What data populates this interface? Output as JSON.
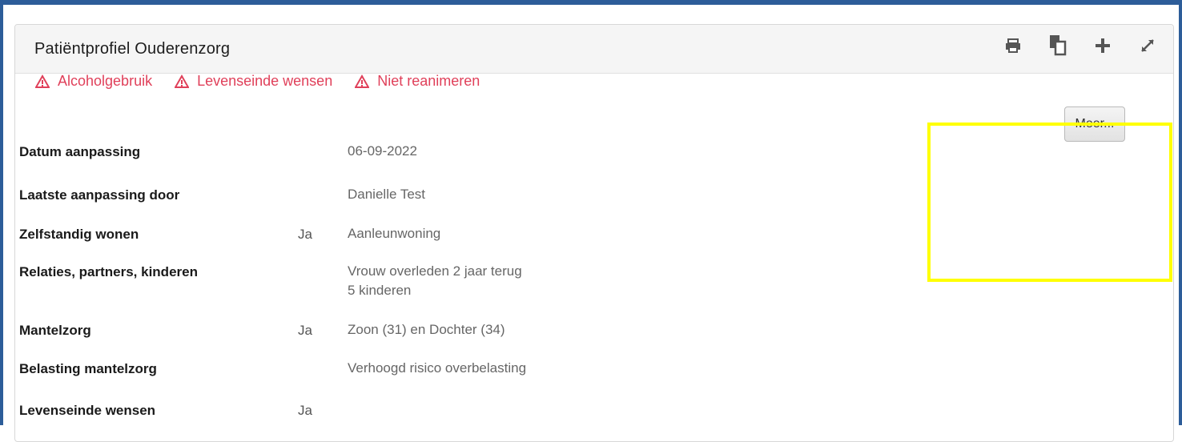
{
  "panel": {
    "title": "Patiëntprofiel Ouderenzorg",
    "header_icons": [
      "print-icon",
      "copy-icon",
      "plus-icon",
      "expand-icon"
    ]
  },
  "alerts": [
    {
      "label": "Alcoholgebruik",
      "icon": "warning-icon",
      "color": "#e0405a"
    },
    {
      "label": "Levenseinde wensen",
      "icon": "warning-icon",
      "color": "#e0405a"
    },
    {
      "label": "Niet reanimeren",
      "icon": "warning-icon",
      "color": "#e0405a"
    }
  ],
  "rows": [
    {
      "label": "Datum aanpassing",
      "flag": "",
      "value": [
        "06-09-2022"
      ]
    },
    {
      "label": "Laatste aanpassing door",
      "flag": "",
      "value": [
        "Danielle Test"
      ]
    },
    {
      "label": "Zelfstandig wonen",
      "flag": "Ja",
      "value": [
        "Aanleunwoning"
      ]
    },
    {
      "label": "Relaties, partners, kinderen",
      "flag": "",
      "value": [
        "Vrouw overleden 2 jaar terug",
        "5 kinderen"
      ]
    },
    {
      "label": "Mantelzorg",
      "flag": "Ja",
      "value": [
        "Zoon (31) en Dochter (34)"
      ]
    },
    {
      "label": "Belasting mantelzorg",
      "flag": "",
      "value": [
        "Verhoogd risico overbelasting"
      ]
    },
    {
      "label": "Levenseinde wensen",
      "flag": "Ja",
      "value": [
        ""
      ]
    }
  ],
  "meer_button": {
    "label": "Meer..."
  },
  "highlight_color": "#ffff00",
  "frame_color": "#2d5d99"
}
